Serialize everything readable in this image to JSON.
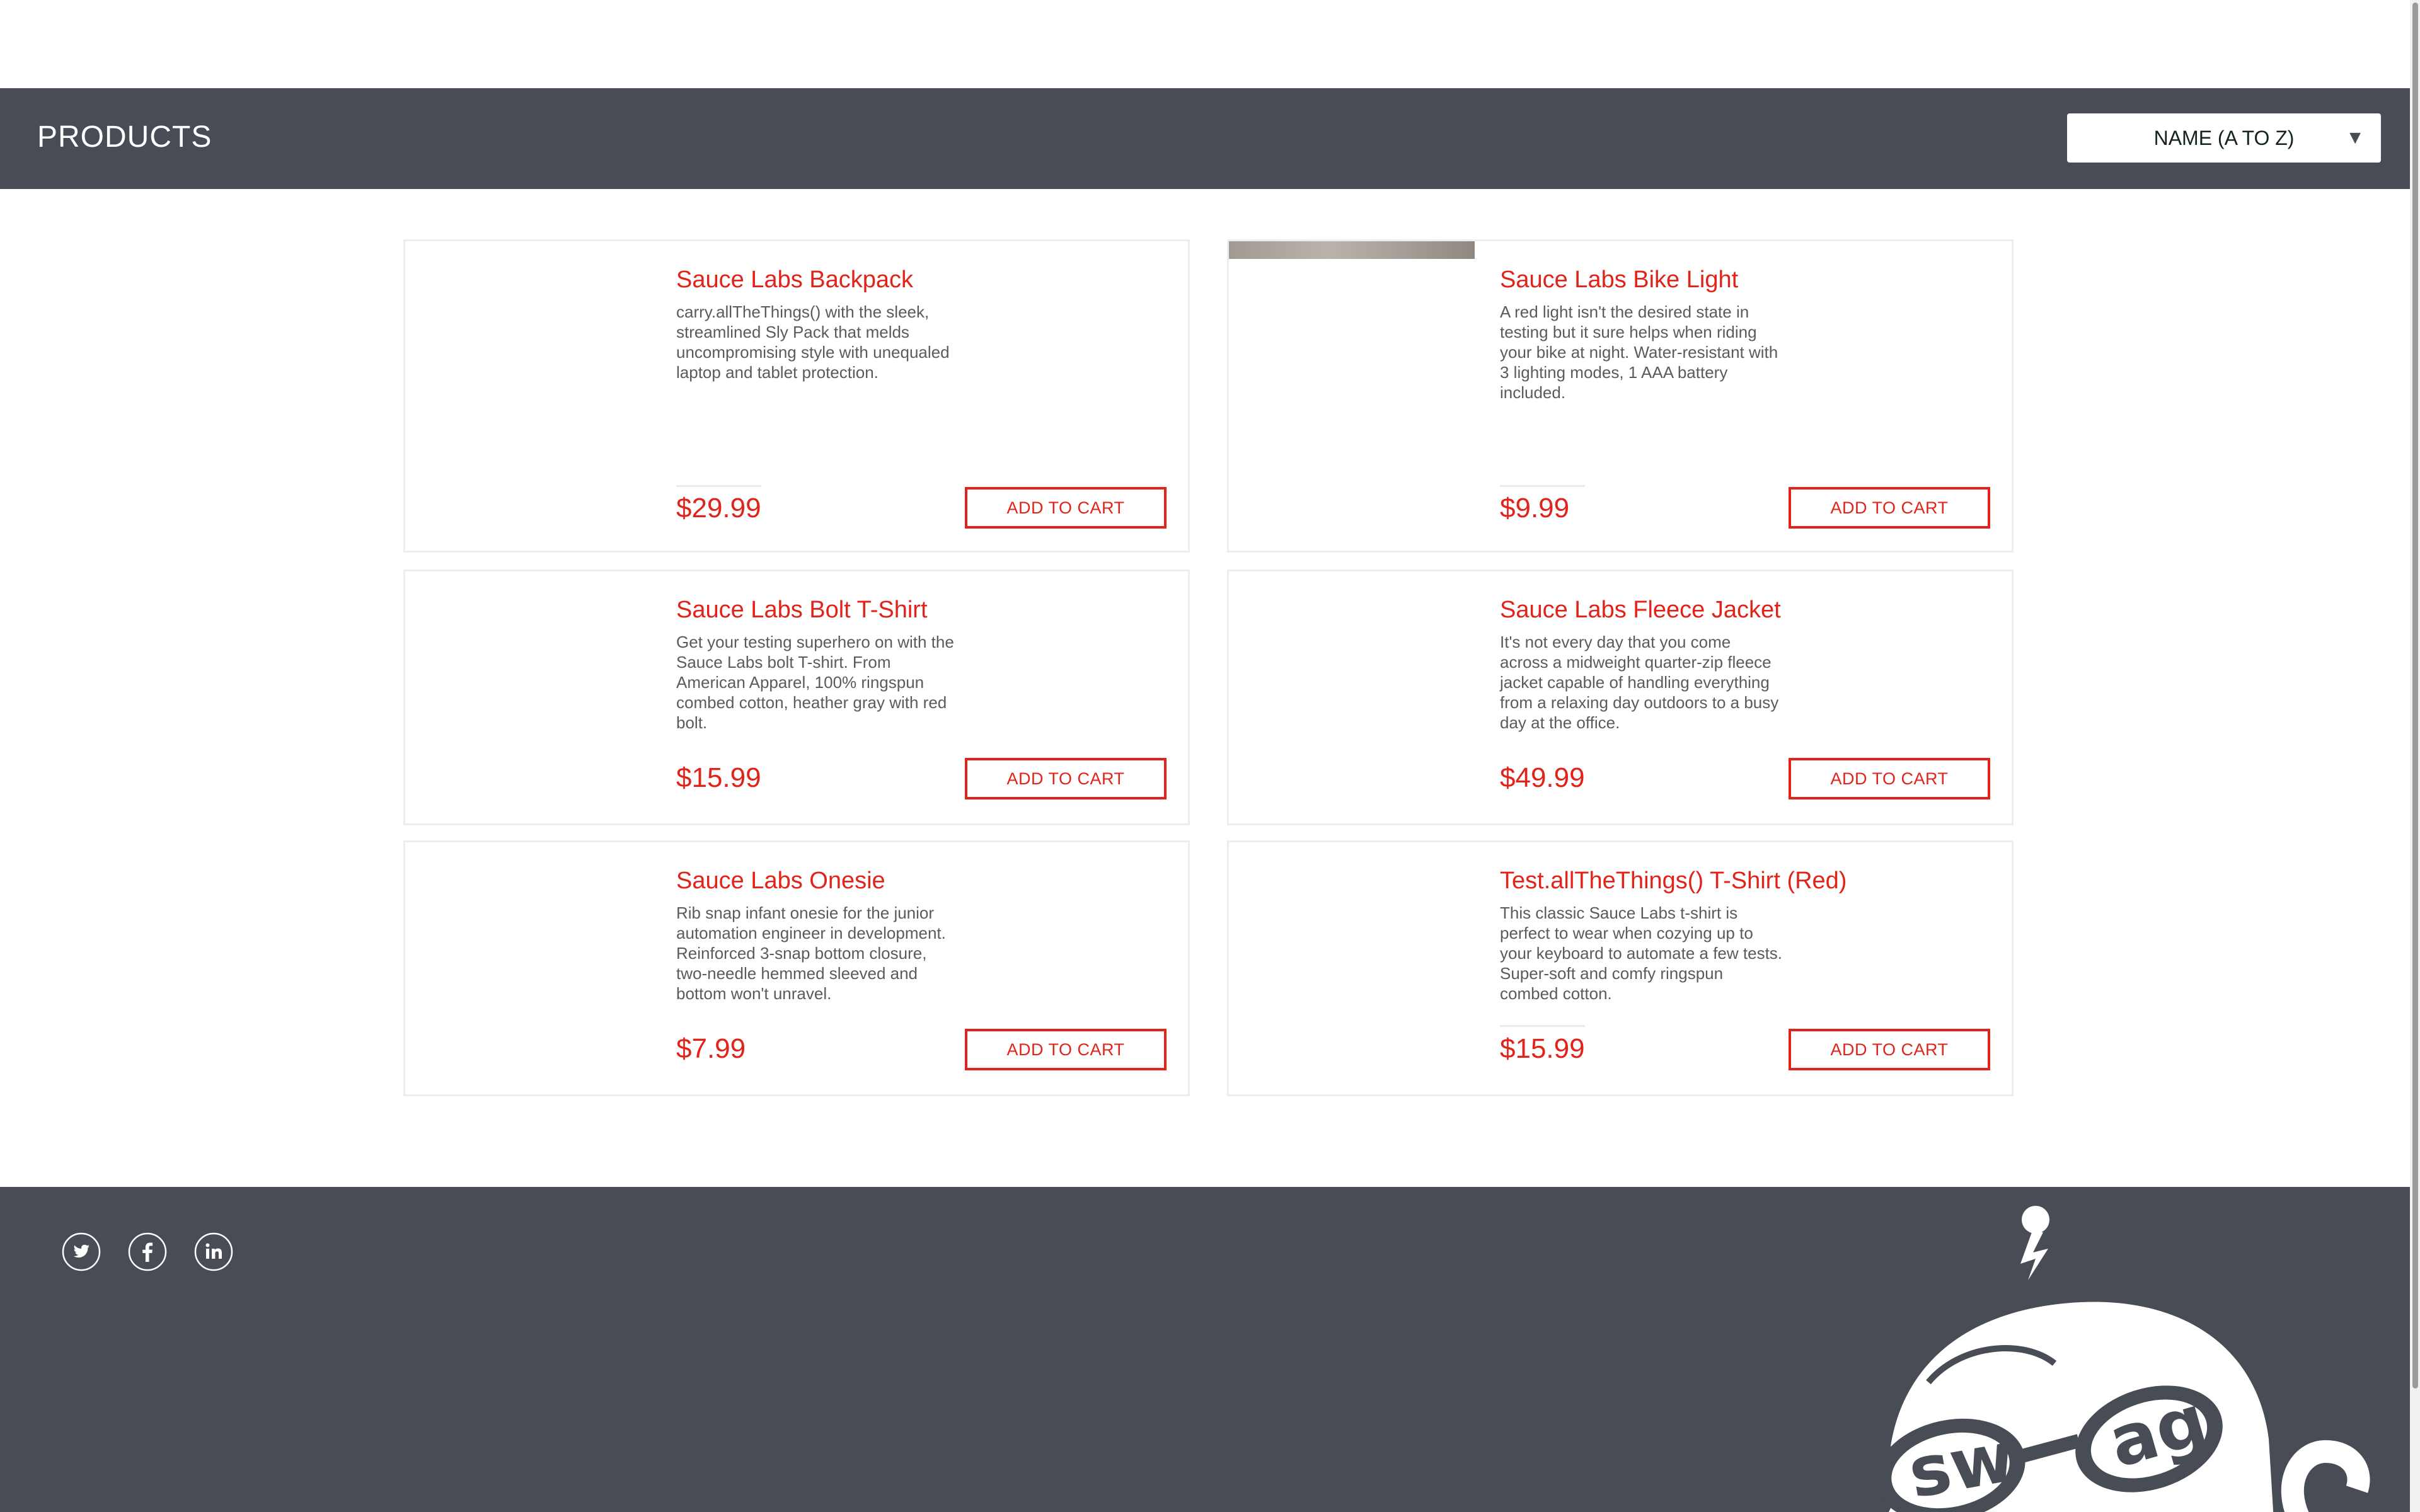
{
  "header": {
    "title": "PRODUCTS",
    "sort": {
      "selected": "NAME (A TO Z)",
      "arrow_icon": "triangle-down-icon"
    }
  },
  "products": [
    {
      "name": "Sauce Labs Backpack",
      "description": "carry.allTheThings() with the sleek, streamlined Sly Pack that melds uncompromising style with unequaled laptop and tablet protection.",
      "price": "$29.99",
      "button": "ADD TO CART"
    },
    {
      "name": "Sauce Labs Bike Light",
      "description": "A red light isn't the desired state in testing but it sure helps when riding your bike at night. Water-resistant with 3 lighting modes, 1 AAA battery included.",
      "price": "$9.99",
      "button": "ADD TO CART"
    },
    {
      "name": "Sauce Labs Bolt T-Shirt",
      "description": "Get your testing superhero on with the Sauce Labs bolt T-shirt. From American Apparel, 100% ringspun combed cotton, heather gray with red bolt.",
      "price": "$15.99",
      "button": "ADD TO CART"
    },
    {
      "name": "Sauce Labs Fleece Jacket",
      "description": "It's not every day that you come across a midweight quarter-zip fleece jacket capable of handling everything from a relaxing day outdoors to a busy day at the office.",
      "price": "$49.99",
      "button": "ADD TO CART"
    },
    {
      "name": "Sauce Labs Onesie",
      "description": "Rib snap infant onesie for the junior automation engineer in development. Reinforced 3-snap bottom closure, two-needle hemmed sleeved and bottom won't unravel.",
      "price": "$7.99",
      "button": "ADD TO CART"
    },
    {
      "name": "Test.allTheThings() T-Shirt (Red)",
      "description": "This classic Sauce Labs t-shirt is perfect to wear when cozying up to your keyboard to automate a few tests. Super-soft and comfy ringspun combed cotton.",
      "price": "$15.99",
      "button": "ADD TO CART"
    }
  ],
  "footer": {
    "social_icons": [
      "twitter-icon",
      "facebook-icon",
      "linkedin-icon"
    ],
    "logo_text": "swag"
  },
  "colors": {
    "accent": "#e2231a",
    "header_bg": "#484c55",
    "footer_bg": "#484c55",
    "description": "#5b5b5b"
  }
}
